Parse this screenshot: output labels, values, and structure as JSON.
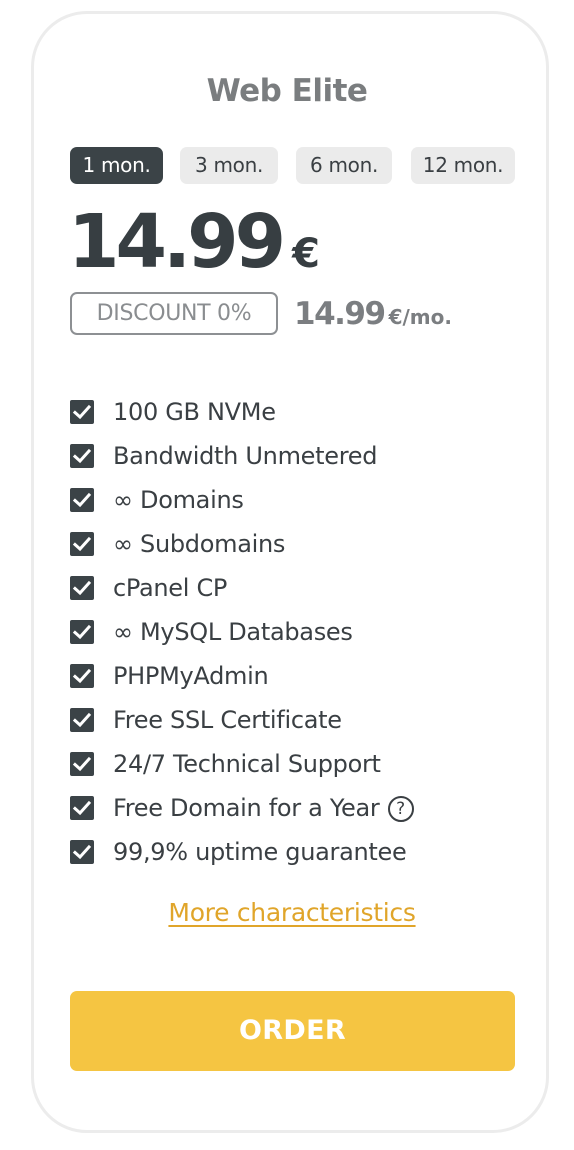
{
  "plan": {
    "title": "Web Elite"
  },
  "periods": [
    {
      "label": "1 mon.",
      "active": true
    },
    {
      "label": "3 mon.",
      "active": false
    },
    {
      "label": "6 mon.",
      "active": false
    },
    {
      "label": "12 mon.",
      "active": false
    }
  ],
  "price": {
    "amount": "14.99",
    "currency": "€"
  },
  "discount": {
    "label": "DISCOUNT 0%"
  },
  "monthly": {
    "amount": "14.99",
    "unit": "€/mo."
  },
  "features": [
    {
      "label": "100 GB NVMe"
    },
    {
      "label": "Bandwidth Unmetered"
    },
    {
      "label": "∞ Domains"
    },
    {
      "label": "∞ Subdomains"
    },
    {
      "label": "cPanel CP"
    },
    {
      "label": "∞ MySQL Databases"
    },
    {
      "label": "PHPMyAdmin"
    },
    {
      "label": "Free SSL Certificate"
    },
    {
      "label": "24/7 Technical Support"
    },
    {
      "label": "Free Domain for a Year",
      "help_icon": "?"
    },
    {
      "label": "99,9% uptime guarantee"
    }
  ],
  "more_link": "More characteristics",
  "order_button": "ORDER",
  "colors": {
    "accent": "#f5c542",
    "link": "#e0a52a",
    "dark": "#3b4347",
    "muted": "#7a7d7f"
  }
}
